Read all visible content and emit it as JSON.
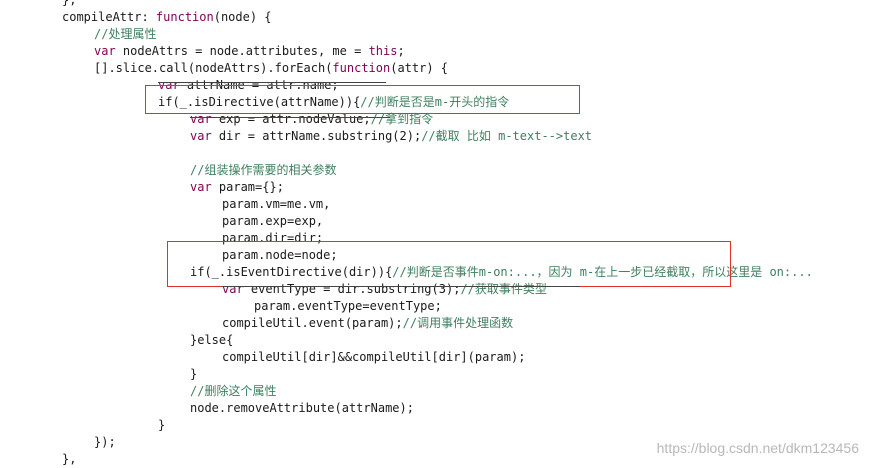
{
  "colors": {
    "keyword": "#7f0055",
    "comment": "#3f7f5f",
    "text": "#1a1a1a",
    "highlight_box": "#e0312a",
    "watermark": "#b8b8b8"
  },
  "code_lines": [
    [
      {
        "t": "},",
        "c": "pn"
      }
    ],
    [
      {
        "t": "compileAttr: ",
        "c": "pn"
      },
      {
        "t": "function",
        "c": "kw"
      },
      {
        "t": "(node) {",
        "c": "pn"
      }
    ],
    [
      {
        "t": "//处理属性",
        "c": "cm"
      }
    ],
    [
      {
        "t": "var",
        "c": "kw"
      },
      {
        "t": " nodeAttrs = node.attributes, me = ",
        "c": "pn"
      },
      {
        "t": "this",
        "c": "kw"
      },
      {
        "t": ";",
        "c": "pn"
      }
    ],
    [
      {
        "t": "[].slice.call(nodeAttrs).forEach(",
        "c": "pn"
      },
      {
        "t": "function",
        "c": "kw"
      },
      {
        "t": "(attr) {",
        "c": "pn"
      }
    ],
    [
      {
        "t": "var",
        "c": "kw"
      },
      {
        "t": " attrName = attr.name;",
        "c": "pn"
      }
    ],
    [
      {
        "t": "if(_.isDirective(attrName)){",
        "c": "pn"
      },
      {
        "t": "//判断是否是m-开头的指令",
        "c": "cm"
      }
    ],
    [
      {
        "t": "var",
        "c": "kw"
      },
      {
        "t": " exp = attr.nodeValue;",
        "c": "pn"
      },
      {
        "t": "//拿到指令",
        "c": "cm"
      }
    ],
    [
      {
        "t": "var",
        "c": "kw"
      },
      {
        "t": " dir = attrName.substring(2);",
        "c": "pn"
      },
      {
        "t": "//截取 比如 m-text-->text",
        "c": "cm"
      }
    ],
    [
      {
        "t": "",
        "c": "pn"
      }
    ],
    [
      {
        "t": "//组装操作需要的相关参数",
        "c": "cm"
      }
    ],
    [
      {
        "t": "var",
        "c": "kw"
      },
      {
        "t": " param={};",
        "c": "pn"
      }
    ],
    [
      {
        "t": "param.vm=me.vm,",
        "c": "pn"
      }
    ],
    [
      {
        "t": "param.exp=exp,",
        "c": "pn"
      }
    ],
    [
      {
        "t": "param.dir=dir;",
        "c": "pn"
      }
    ],
    [
      {
        "t": "param.node=node;",
        "c": "pn"
      }
    ],
    [
      {
        "t": "if(_.isEventDirective(dir)){",
        "c": "pn"
      },
      {
        "t": "//判断是否事件m-on:...，因为 m-在上一步已经截取，所以这里是 on:...",
        "c": "cm"
      }
    ],
    [
      {
        "t": "var",
        "c": "kw"
      },
      {
        "t": " eventType = dir.substring(3);",
        "c": "pn"
      },
      {
        "t": "//获取事件类型",
        "c": "cm"
      }
    ],
    [
      {
        "t": "param.eventType=eventType;",
        "c": "pn"
      }
    ],
    [
      {
        "t": "compileUtil.event(param);",
        "c": "pn"
      },
      {
        "t": "//调用事件处理函数",
        "c": "cm"
      }
    ],
    [
      {
        "t": "}else{",
        "c": "pn"
      }
    ],
    [
      {
        "t": "compileUtil[dir]&&compileUtil[dir](param);",
        "c": "pn"
      }
    ],
    [
      {
        "t": "}",
        "c": "pn"
      }
    ],
    [
      {
        "t": "//删除这个属性",
        "c": "cm"
      }
    ],
    [
      {
        "t": "node.removeAttribute(attrName);",
        "c": "pn"
      }
    ],
    [
      {
        "t": "}",
        "c": "pn"
      }
    ],
    [
      {
        "t": "});",
        "c": "pn"
      }
    ],
    [
      {
        "t": "},",
        "c": "pn"
      }
    ]
  ],
  "watermark": "https://blog.csdn.net/dkm123456"
}
